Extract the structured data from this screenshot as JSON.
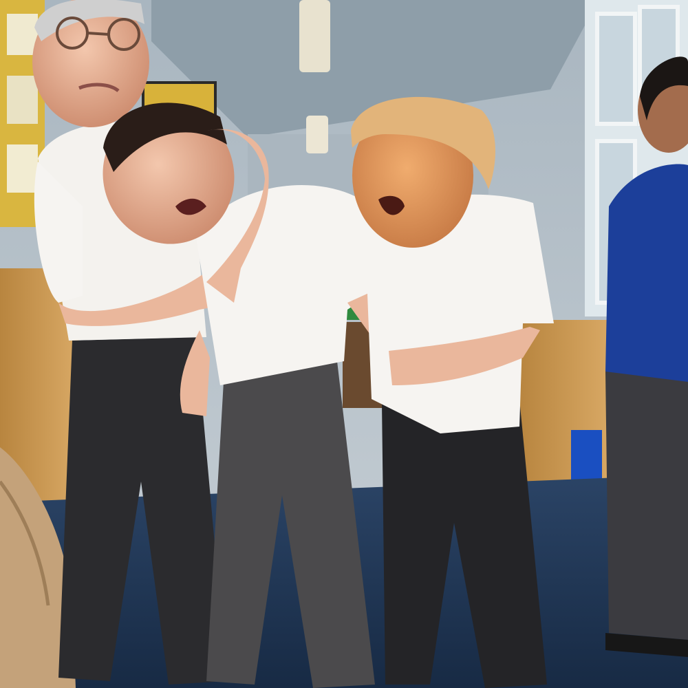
{
  "image": {
    "kind": "photo-meme",
    "scene": "school-corridor",
    "figures": [
      {
        "role": "restrainer-left"
      },
      {
        "role": "held-middle"
      },
      {
        "role": "grabber-right"
      },
      {
        "role": "bystander-blue-jumper"
      }
    ],
    "colors": {
      "wall": "#bcc6cf",
      "ceiling": "#9aa8b2",
      "floor": "#1f3552",
      "cabinet": "#c99a5a",
      "shirt": "#f4f2ee",
      "trousers": "#2b2b2e",
      "skin": "#e9b79a",
      "sweater": "#1c3f9a",
      "hair_orange": "#e2b47a"
    }
  }
}
